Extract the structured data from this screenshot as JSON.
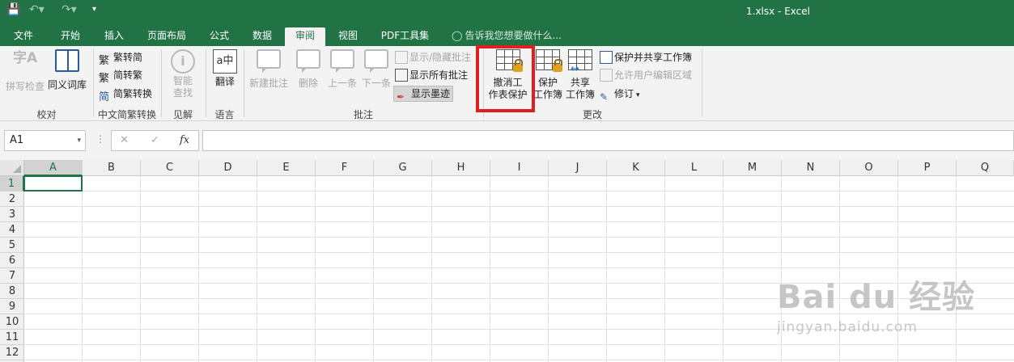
{
  "window": {
    "title": "1.xlsx - Excel"
  },
  "quick_access": {
    "save_icon": "save-icon",
    "undo_icon": "undo-icon",
    "redo_icon": "redo-icon",
    "customize_icon": "customize-icon"
  },
  "tabs": [
    {
      "label": "文件"
    },
    {
      "label": "开始"
    },
    {
      "label": "插入"
    },
    {
      "label": "页面布局"
    },
    {
      "label": "公式"
    },
    {
      "label": "数据"
    },
    {
      "label": "审阅"
    },
    {
      "label": "视图"
    },
    {
      "label": "PDF工具集"
    }
  ],
  "active_tab": "审阅",
  "tell_me": "告诉我您想要做什么...",
  "ribbon": {
    "proofing": {
      "spell": "拼写检查",
      "thesaurus": "同义词库",
      "label": "校对"
    },
    "chinese": {
      "to_traditional": "繁转简",
      "to_simplified": "简转繁",
      "convert": "简繁转换",
      "label": "中文简繁转换"
    },
    "insights": {
      "smart1": "智能",
      "smart2": "查找",
      "label": "见解"
    },
    "language": {
      "translate": "翻译",
      "label": "语言"
    },
    "comments": {
      "new": "新建批注",
      "delete": "删除",
      "prev": "上一条",
      "next": "下一条",
      "show_hide": "显示/隐藏批注",
      "show_all": "显示所有批注",
      "show_ink": "显示墨迹",
      "label": "批注"
    },
    "changes": {
      "unprotect1": "撤消工",
      "unprotect2": "作表保护",
      "protect_wb1": "保护",
      "protect_wb2": "工作簿",
      "share1": "共享",
      "share2": "工作簿",
      "protect_share": "保护并共享工作簿",
      "allow_edit": "允许用户编辑区域",
      "track": "修订",
      "label": "更改"
    }
  },
  "formula_bar": {
    "name_box": "A1",
    "cancel": "✕",
    "enter": "✓",
    "fx": "fx",
    "value": ""
  },
  "grid": {
    "columns": [
      "A",
      "B",
      "C",
      "D",
      "E",
      "F",
      "G",
      "H",
      "I",
      "J",
      "K",
      "L",
      "M",
      "N",
      "O",
      "P",
      "Q"
    ],
    "rows": [
      "1",
      "2",
      "3",
      "4",
      "5",
      "6",
      "7",
      "8",
      "9",
      "10",
      "11",
      "12"
    ],
    "selected_cell": "A1"
  },
  "watermark": {
    "brand": "Bai du 经验",
    "url": "jingyan.baidu.com"
  },
  "colors": {
    "accent": "#217346",
    "highlight": "#e02020"
  }
}
